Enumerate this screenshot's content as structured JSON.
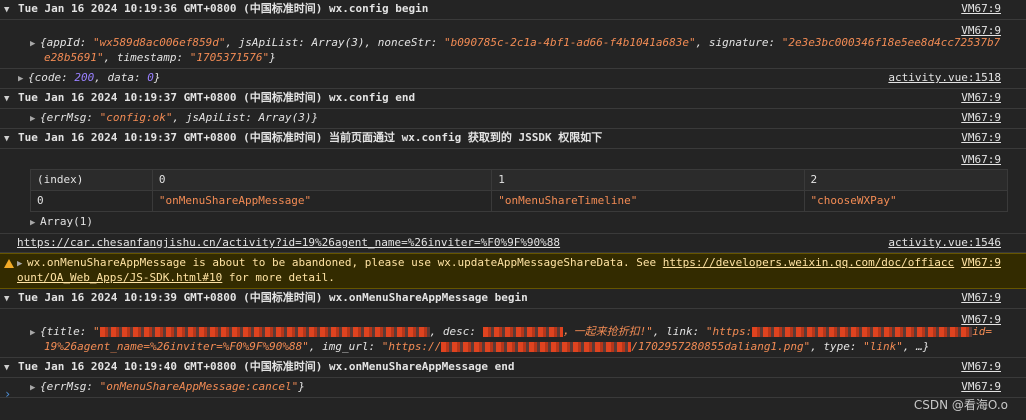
{
  "groups": [
    {
      "header": "Tue Jan 16 2024 10:19:36 GMT+0800 (中国标准时间) wx.config begin",
      "source": "VM67:9",
      "obj_source": "VM67:9",
      "appId": "\"wx589d8ac006ef859d\"",
      "jsApiList": "Array(3)",
      "nonceStr": "\"b090785c-2c1a-4bf1-ad66-f4b1041a683e\"",
      "signature_line1": "\"2e3e3bc000346f18e5ee8d4cc72537b7",
      "signature_line2": "e28b5691\"",
      "timestamp": "\"1705371576\""
    }
  ],
  "code_line": {
    "code": "200",
    "data": "0",
    "source": "activity.vue:1518"
  },
  "config_end": {
    "header": "Tue Jan 16 2024 10:19:37 GMT+0800 (中国标准时间) wx.config end",
    "source": "VM67:9",
    "obj_source": "VM67:9",
    "errMsg": "\"config:ok\"",
    "jsApiList": "Array(3)"
  },
  "jssdk": {
    "header": "Tue Jan 16 2024 10:19:37 GMT+0800 (中国标准时间) 当前页面通过 wx.config 获取到的 JSSDK 权限如下",
    "source": "VM67:9",
    "table_source": "VM67:9",
    "columns": [
      "(index)",
      "0",
      "1",
      "2"
    ],
    "rows": [
      [
        "0",
        "\"onMenuShareAppMessage\"",
        "\"onMenuShareTimeline\"",
        "\"chooseWXPay\""
      ]
    ],
    "array_label": "Array(1)"
  },
  "url_line": {
    "text": "https://car.chesanfangjishu.cn/activity?id=19%26agent_name=%26inviter=%F0%9F%90%88",
    "source": "activity.vue:1546"
  },
  "warning": {
    "msg": "wx.onMenuShareAppMessage is about to be abandoned, please use wx.updateAppMessageShareData. See ",
    "link1": "https://developers.weixin.qq.com/doc/offiacc",
    "link2": "ount/OA_Web_Apps/JS-SDK.html#10",
    "tail": " for more detail.",
    "source": "VM67:9"
  },
  "share_begin": {
    "header": "Tue Jan 16 2024 10:19:39 GMT+0800 (中国标准时间) wx.onMenuShareAppMessage begin",
    "source": "VM67:9",
    "obj_source": "VM67:9",
    "title_prefix": "\"",
    "desc_suffix": "，一起来抢折扣!\"",
    "link_prefix": "\"https:",
    "link_suffix": "id=",
    "line2_link": "19%26agent_name=%26inviter=%F0%9F%90%88\"",
    "img_url_prefix": "\"https://",
    "img_url_suffix": "/1702957280855daliang1.png\"",
    "type": "\"link\"",
    "ellipsis": "…}"
  },
  "share_end": {
    "header": "Tue Jan 16 2024 10:19:40 GMT+0800 (中国标准时间) wx.onMenuShareAppMessage end",
    "source": "VM67:9",
    "obj_source": "VM67:9",
    "errMsg": "\"onMenuShareAppMessage:cancel\""
  },
  "watermark": "CSDN @看海O.o"
}
